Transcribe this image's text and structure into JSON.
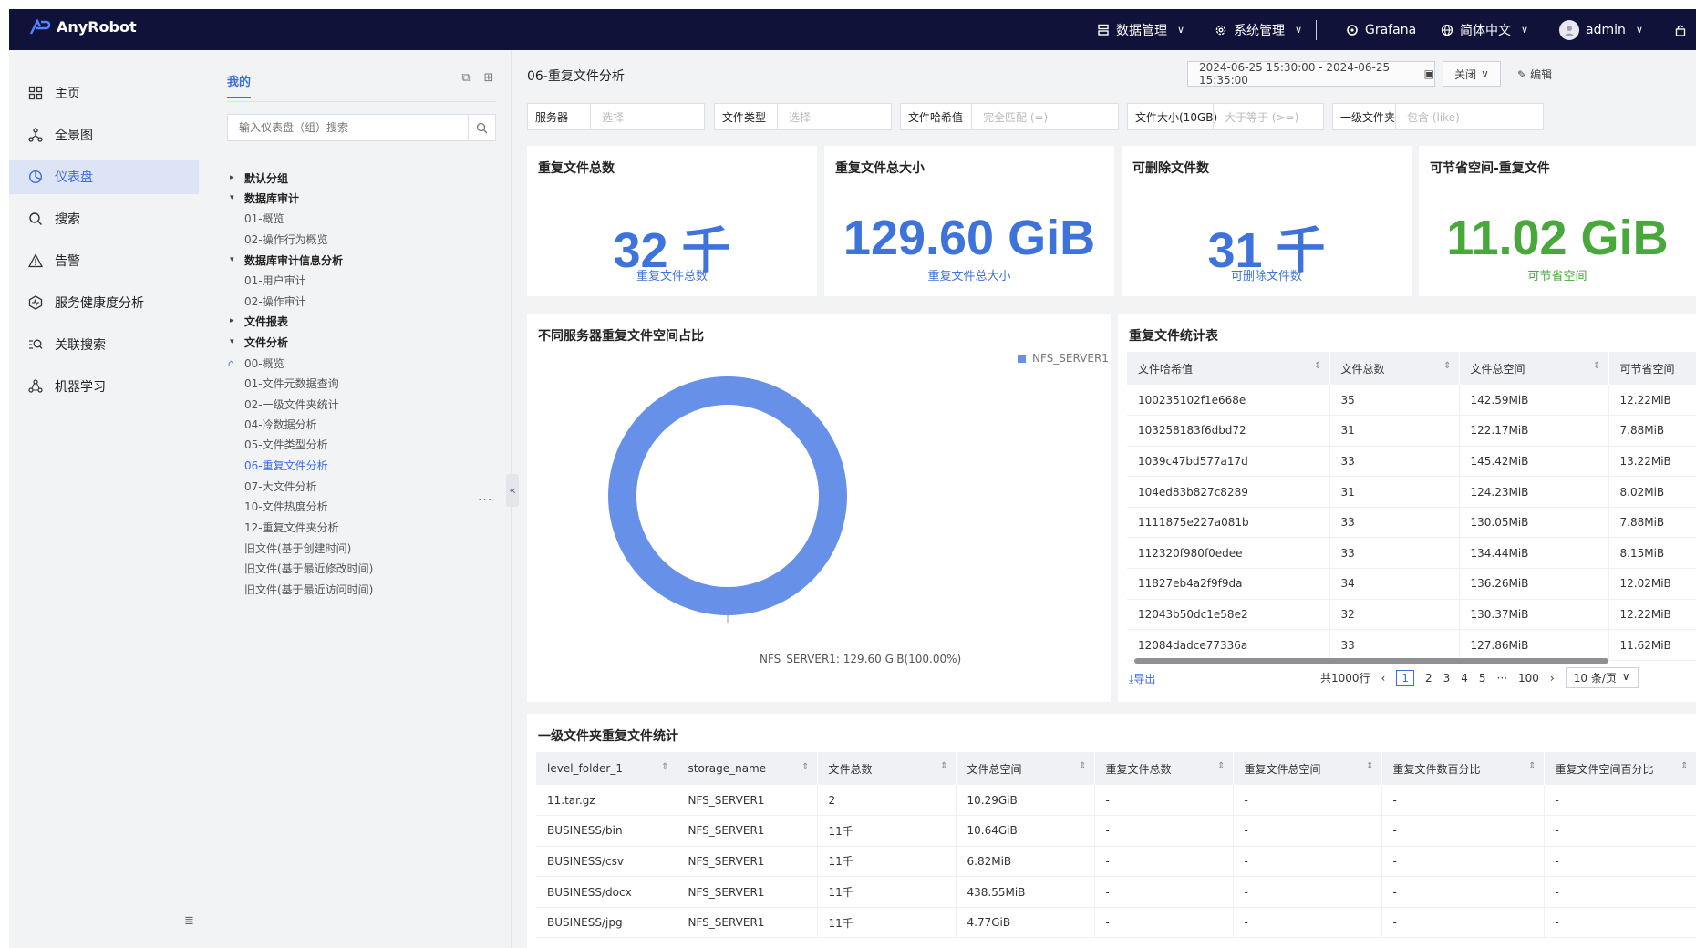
{
  "app": {
    "name": "AnyRobot"
  },
  "topnav": {
    "data_mgmt": "数据管理",
    "sys_mgmt": "系统管理",
    "grafana": "Grafana",
    "lang": "简体中文",
    "user": "admin"
  },
  "sidebar": {
    "items": [
      {
        "label": "主页",
        "icon": "grid-icon"
      },
      {
        "label": "全景图",
        "icon": "topology-icon"
      },
      {
        "label": "仪表盘",
        "icon": "dashboard-icon"
      },
      {
        "label": "搜索",
        "icon": "search-icon"
      },
      {
        "label": "告警",
        "icon": "alert-icon"
      },
      {
        "label": "服务健康度分析",
        "icon": "health-icon"
      },
      {
        "label": "关联搜索",
        "icon": "link-search-icon"
      },
      {
        "label": "机器学习",
        "icon": "ml-icon"
      }
    ]
  },
  "tree": {
    "tab": "我的",
    "search_placeholder": "输入仪表盘（组）搜索",
    "nodes": [
      {
        "label": "默认分组",
        "type": "group",
        "arrow": "▸"
      },
      {
        "label": "数据库审计",
        "type": "group",
        "arrow": "▾"
      },
      {
        "label": "01-概览",
        "type": "leaf"
      },
      {
        "label": "02-操作行为概览",
        "type": "leaf"
      },
      {
        "label": "数据库审计信息分析",
        "type": "group",
        "arrow": "▾"
      },
      {
        "label": "01-用户审计",
        "type": "leaf"
      },
      {
        "label": "02-操作审计",
        "type": "leaf"
      },
      {
        "label": "文件报表",
        "type": "group",
        "arrow": "▸"
      },
      {
        "label": "文件分析",
        "type": "group",
        "arrow": "▾"
      },
      {
        "label": "00-概览",
        "type": "leaf"
      },
      {
        "label": "01-文件元数据查询",
        "type": "leaf"
      },
      {
        "label": "02-一级文件夹统计",
        "type": "leaf"
      },
      {
        "label": "04-冷数据分析",
        "type": "leaf"
      },
      {
        "label": "05-文件类型分析",
        "type": "leaf"
      },
      {
        "label": "06-重复文件分析",
        "type": "leaf",
        "selected": true
      },
      {
        "label": "07-大文件分析",
        "type": "leaf"
      },
      {
        "label": "10-文件热度分析",
        "type": "leaf"
      },
      {
        "label": "12-重复文件夹分析",
        "type": "leaf"
      },
      {
        "label": "旧文件(基于创建时间)",
        "type": "leaf"
      },
      {
        "label": "旧文件(基于最近修改时间)",
        "type": "leaf"
      },
      {
        "label": "旧文件(基于最近访问时间)",
        "type": "leaf"
      }
    ]
  },
  "page": {
    "title": "06-重复文件分析",
    "daterange": "2024-06-25 15:30:00 - 2024-06-25 15:35:00",
    "refresh": "关闭",
    "edit": "编辑"
  },
  "filters": [
    {
      "label": "服务器",
      "placeholder": "选择"
    },
    {
      "label": "文件类型",
      "placeholder": "选择"
    },
    {
      "label": "文件哈希值",
      "placeholder": "完全匹配 (=)"
    },
    {
      "label": "文件大小(10GB)",
      "placeholder": "大于等于 (>=)"
    },
    {
      "label": "一级文件夹",
      "placeholder": "包含 (like)"
    }
  ],
  "stats": [
    {
      "title": "重复文件总数",
      "value": "32 千",
      "caption": "重复文件总数",
      "color": "#3d73da"
    },
    {
      "title": "重复文件总大小",
      "value": "129.60 GiB",
      "caption": "重复文件总大小",
      "color": "#3d73da"
    },
    {
      "title": "可删除文件数",
      "value": "31 千",
      "caption": "可删除文件数",
      "color": "#3d73da"
    },
    {
      "title": "可节省空间-重复文件",
      "value": "11.02 GiB",
      "caption": "可节省空间",
      "color": "#49a83b"
    }
  ],
  "chart_data": {
    "type": "pie",
    "title": "不同服务器重复文件空间占比",
    "legend_position": "top-right",
    "slices": [
      {
        "name": "NFS_SERVER1",
        "value": 129.6,
        "unit": "GiB",
        "percent": 100.0,
        "color": "#6790e9"
      }
    ],
    "label": "NFS_SERVER1: 129.60 GiB(100.00%)",
    "donut": true
  },
  "hash_table": {
    "title": "重复文件统计表",
    "columns": [
      "文件哈希值",
      "文件总数",
      "文件总空间",
      "可节省空间"
    ],
    "rows": [
      [
        "100235102f1e668e",
        "35",
        "142.59MiB",
        "12.22MiB"
      ],
      [
        "103258183f6dbd72",
        "31",
        "122.17MiB",
        "7.88MiB"
      ],
      [
        "1039c47bd577a17d",
        "33",
        "145.42MiB",
        "13.22MiB"
      ],
      [
        "104ed83b827c8289",
        "31",
        "124.23MiB",
        "8.02MiB"
      ],
      [
        "1111875e227a081b",
        "33",
        "130.05MiB",
        "7.88MiB"
      ],
      [
        "112320f980f0edee",
        "33",
        "134.44MiB",
        "8.15MiB"
      ],
      [
        "11827eb4a2f9f9da",
        "34",
        "136.26MiB",
        "12.02MiB"
      ],
      [
        "12043b50dc1e58e2",
        "32",
        "130.37MiB",
        "12.22MiB"
      ],
      [
        "12084dadce77336a",
        "33",
        "127.86MiB",
        "11.62MiB"
      ]
    ],
    "export": "导出",
    "total": "共1000行",
    "pages": [
      "1",
      "2",
      "3",
      "4",
      "5",
      "···",
      "100"
    ],
    "page_size": "10 条/页"
  },
  "folder_table": {
    "title": "一级文件夹重复文件统计",
    "columns": [
      "level_folder_1",
      "storage_name",
      "文件总数",
      "文件总空间",
      "重复文件总数",
      "重复文件总空间",
      "重复文件数百分比",
      "重复文件空间百分比"
    ],
    "rows": [
      [
        "11.tar.gz",
        "NFS_SERVER1",
        "2",
        "10.29GiB",
        "-",
        "-",
        "-",
        "-"
      ],
      [
        "BUSINESS/bin",
        "NFS_SERVER1",
        "11千",
        "10.64GiB",
        "-",
        "-",
        "-",
        "-"
      ],
      [
        "BUSINESS/csv",
        "NFS_SERVER1",
        "11千",
        "6.82MiB",
        "-",
        "-",
        "-",
        "-"
      ],
      [
        "BUSINESS/docx",
        "NFS_SERVER1",
        "11千",
        "438.55MiB",
        "-",
        "-",
        "-",
        "-"
      ],
      [
        "BUSINESS/jpg",
        "NFS_SERVER1",
        "11千",
        "4.77GiB",
        "-",
        "-",
        "-",
        "-"
      ]
    ]
  }
}
